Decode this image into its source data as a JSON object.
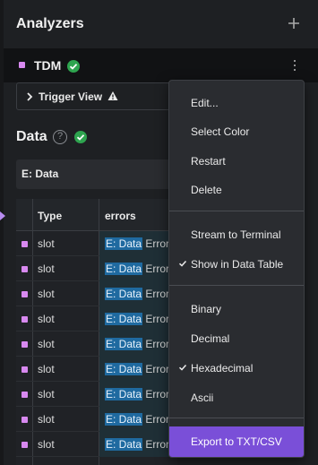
{
  "header": {
    "title": "Analyzers",
    "add_icon": "plus-icon"
  },
  "analyzer": {
    "name": "TDM",
    "color": "#d889f0",
    "status": "ok"
  },
  "trigger": {
    "label": "Trigger View"
  },
  "data_section": {
    "title": "Data",
    "search_value": "E: Data"
  },
  "table": {
    "columns": [
      "Type",
      "errors"
    ],
    "rows": [
      {
        "type": "slot",
        "errors_highlight": "E: Data",
        "errors_rest": " Error"
      },
      {
        "type": "slot",
        "errors_highlight": "E: Data",
        "errors_rest": " Error"
      },
      {
        "type": "slot",
        "errors_highlight": "E: Data",
        "errors_rest": " Error"
      },
      {
        "type": "slot",
        "errors_highlight": "E: Data",
        "errors_rest": " Error"
      },
      {
        "type": "slot",
        "errors_highlight": "E: Data",
        "errors_rest": " Error"
      },
      {
        "type": "slot",
        "errors_highlight": "E: Data",
        "errors_rest": " Error"
      },
      {
        "type": "slot",
        "errors_highlight": "E: Data",
        "errors_rest": " Error"
      },
      {
        "type": "slot",
        "errors_highlight": "E: Data",
        "errors_rest": " Error"
      },
      {
        "type": "slot",
        "errors_highlight": "E: Data",
        "errors_rest": " Error"
      }
    ]
  },
  "menu": {
    "items": [
      {
        "label": "Edit...",
        "checked": false
      },
      {
        "label": "Select Color",
        "checked": false
      },
      {
        "label": "Restart",
        "checked": false
      },
      {
        "label": "Delete",
        "checked": false
      },
      {
        "label": "Stream to Terminal",
        "checked": false
      },
      {
        "label": "Show in Data Table",
        "checked": true
      },
      {
        "label": "Binary",
        "checked": false
      },
      {
        "label": "Decimal",
        "checked": false
      },
      {
        "label": "Hexadecimal",
        "checked": true
      },
      {
        "label": "Ascii",
        "checked": false
      }
    ],
    "export_label": "Export to TXT/CSV"
  },
  "colors": {
    "accent": "#7a4fd8",
    "ok_green": "#2ea44f",
    "highlight": "#1f6aa0"
  }
}
